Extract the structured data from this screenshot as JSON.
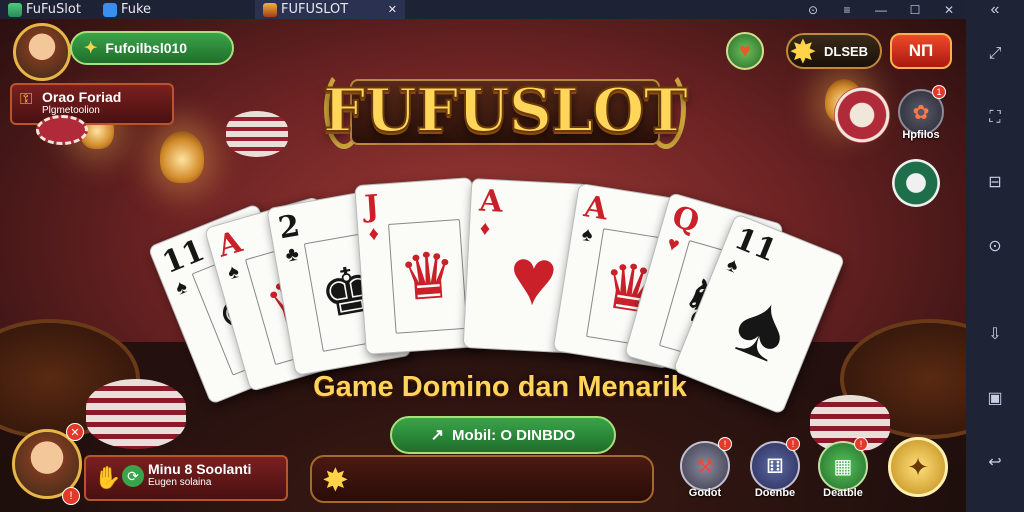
{
  "window": {
    "app_tab": "FuFuSlot",
    "tab2": "Fuke",
    "tab3": "FUFUSLOT",
    "tab3_close": "✕",
    "controls": [
      "⊙",
      "≡",
      "—",
      "☐",
      "✕"
    ]
  },
  "sidebar": {
    "top_icon": "«",
    "buttons": [
      "expand-icon",
      "fullscreen-icon",
      "minimize-icon",
      "rotate-icon",
      "install-icon",
      "folder-icon",
      "back-icon"
    ]
  },
  "player_top": {
    "name": "Fufoilbsl010",
    "tag_title": "Orao Foriad",
    "tag_sub": "Plgmetoolion"
  },
  "top_right": {
    "balance_label": "DLSEB",
    "action_label": "NП"
  },
  "logo": "FUFUSLOT",
  "subtitle": "Game Domino dan Menarik",
  "mobile_button": "Mobil: O DINBDO",
  "player_bottom": {
    "title": "Minu 8 Soolanti",
    "sub": "Eugen solaina"
  },
  "bottom_buttons": [
    {
      "label": "Godot"
    },
    {
      "label": "Doenbe"
    },
    {
      "label": "Deatble"
    }
  ],
  "right_side": {
    "hotfiles_label": "Hpfilos"
  },
  "cards": [
    {
      "rank": "11",
      "suit": "♠",
      "color": "blk"
    },
    {
      "rank": "A",
      "suit": "♠",
      "color": "red"
    },
    {
      "rank": "2",
      "suit": "♣",
      "color": "blk"
    },
    {
      "rank": "J",
      "suit": "♦",
      "color": "red"
    },
    {
      "rank": "A",
      "suit": "♦",
      "color": "red"
    },
    {
      "rank": "A",
      "suit": "♠",
      "color": "red"
    },
    {
      "rank": "Q",
      "suit": "♥",
      "color": "red"
    },
    {
      "rank": "11",
      "suit": "♠",
      "color": "blk"
    }
  ],
  "colors": {
    "accent_gold": "#ffd45a",
    "felt_red": "#6e2324",
    "green_button": "#2f8a3c"
  }
}
